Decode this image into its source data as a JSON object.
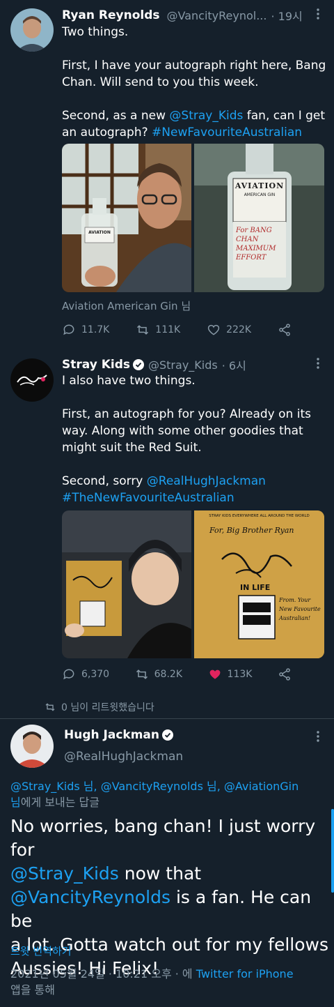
{
  "tweet1": {
    "name": "Ryan Reynolds",
    "handle": "@VancityReynol...",
    "time": "· 19시",
    "line1": "Two things.",
    "line2a": "First, I have your autograph right here, Bang",
    "line2b": "Chan. Will send to you this week.",
    "line3a_pre": "Second, as a new ",
    "line3a_link": "@Stray_Kids",
    "line3a_post": " fan, can I get",
    "line3b_pre": "an autograph? ",
    "line3b_link": "#NewFavouriteAustralian",
    "bottle_brand": "AVIATION",
    "bottle_sub": "AMERICAN GIN",
    "bottle_sign": "For BANG CHAN MAXIMUM EFFORT",
    "caption": "Aviation American Gin 님",
    "replies": "11.7K",
    "retweets": "111K",
    "likes": "222K"
  },
  "tweet2": {
    "name": "Stray Kids",
    "handle": "@Stray_Kids",
    "time": "· 6시",
    "line1": "I also have two things.",
    "line2a": "First, an autograph for you? Already on its",
    "line2b": "way. Along with some other goodies that",
    "line2c": "might suit the Red Suit.",
    "line3a_pre": "Second, sorry ",
    "line3a_link": "@RealHughJackman",
    "line3b_link": "#TheNewFavouriteAustralian",
    "card_header": "STRAY KIDS EVERYWHERE ALL AROUND THE WORLD",
    "card_for": "For, Big Brother Ryan",
    "card_album": "IN LIFE",
    "card_note": "From. Your New Favourite Australian!",
    "replies": "6,370",
    "retweets": "68.2K",
    "likes": "113K"
  },
  "retweet_notice": "0 님이 리트윗했습니다",
  "tweet3": {
    "name": "Hugh Jackman",
    "handle": "@RealHughJackman",
    "reply_to_l1": "@Stray_Kids 님, @VancityReynolds 님, @AviationGin",
    "reply_to_l2a": "님",
    "reply_to_l2b": "에게 보내는 답글",
    "big1": "No worries, bang chan! I just worry for",
    "big2": "@Stray_Kids",
    "big2b": " now that",
    "big3": "@VancityReynolds",
    "big3b": " is a fan. He can be",
    "big4": "a lot. Gotta watch out for my fellows",
    "big5": "Aussies! Hi Felix!",
    "translate": "트윗 번역하기",
    "meta1": "2021년 05월 24일 · 10:21 오후 · 에 ",
    "meta_link": "Twitter for iPhone",
    "meta2": "앱을 통해"
  },
  "colors": {
    "bg": "#15202b",
    "link": "#1da1f2",
    "gray": "#8899a6",
    "like_active": "#e0245e"
  }
}
